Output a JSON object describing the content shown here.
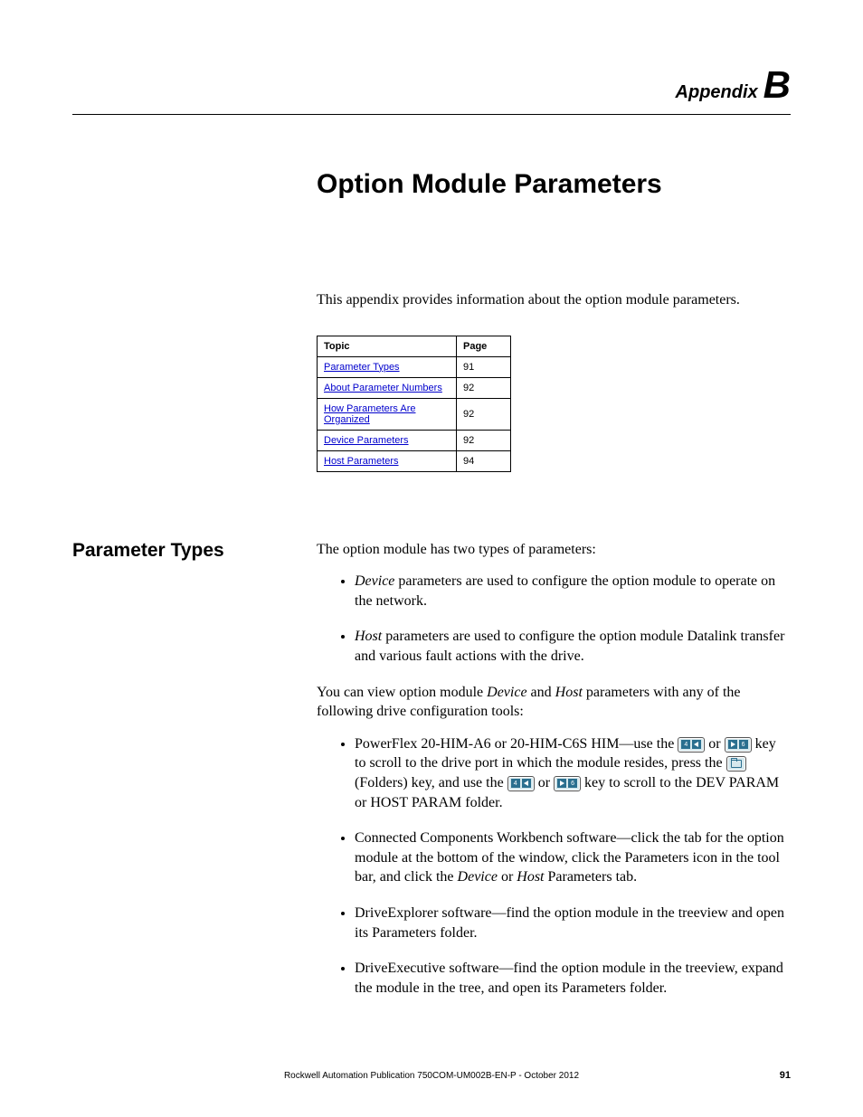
{
  "header": {
    "appendix_word": "Appendix",
    "appendix_letter": "B"
  },
  "title": "Option Module Parameters",
  "intro": "This appendix provides information about the option module parameters.",
  "topics_table": {
    "head": {
      "topic": "Topic",
      "page": "Page"
    },
    "rows": [
      {
        "topic": "Parameter Types",
        "page": "91"
      },
      {
        "topic": "About Parameter Numbers",
        "page": "92"
      },
      {
        "topic": "How Parameters Are Organized",
        "page": "92"
      },
      {
        "topic": "Device Parameters",
        "page": "92"
      },
      {
        "topic": "Host Parameters",
        "page": "94"
      }
    ]
  },
  "section": {
    "heading": "Parameter Types",
    "lead": "The option module has two types of parameters:",
    "param_types": [
      {
        "em": "Device",
        "rest": " parameters are used to configure the option module to operate on the network."
      },
      {
        "em": "Host",
        "rest": " parameters are used to configure the option module Datalink transfer and various fault actions with the drive."
      }
    ],
    "view_lead_a": "You can view option module ",
    "view_em1": "Device",
    "view_mid": " and ",
    "view_em2": "Host",
    "view_lead_b": " parameters with any of the following drive configuration tools:",
    "tools": {
      "him": {
        "a": "PowerFlex 20-HIM-A6 or 20-HIM-C6S HIM—use the ",
        "b": " or ",
        "c": " key to scroll to the drive port in which the module resides, press the ",
        "d": " (Folders) key, and use the ",
        "e": " or ",
        "f": " key to scroll to the DEV PARAM or HOST PARAM folder."
      },
      "ccw": {
        "a": "Connected Components Workbench software—click the tab for the option module at the bottom of the window, click the Parameters icon in the tool bar, and click the ",
        "em1": "Device",
        "mid": " or ",
        "em2": "Host",
        "b": " Parameters tab."
      },
      "dexp": "DriveExplorer software—find the option module in the treeview and open its Parameters folder.",
      "dexe": "DriveExecutive software—find the option module in the treeview, expand the module in the tree, and open its Parameters folder."
    }
  },
  "footer": {
    "publication": "Rockwell Automation Publication 750COM-UM002B-EN-P - October 2012",
    "page_number": "91"
  }
}
